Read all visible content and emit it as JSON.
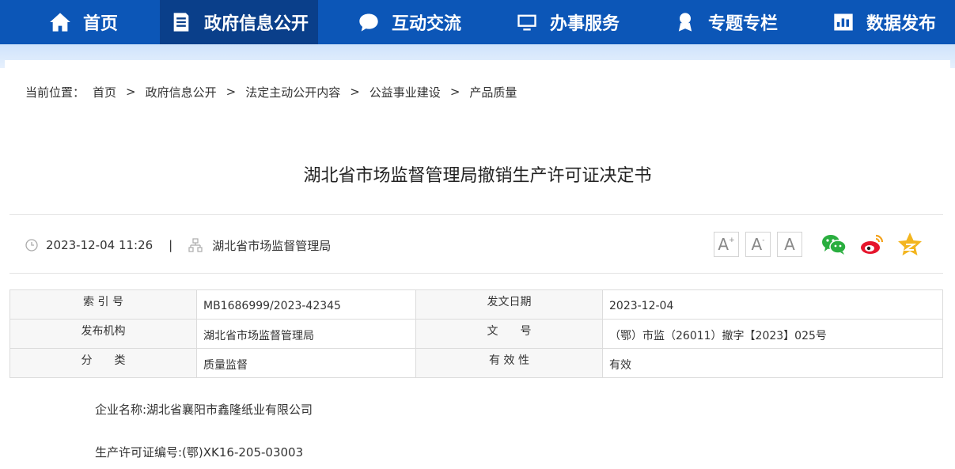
{
  "nav": {
    "items": [
      {
        "label": "首页",
        "icon": "home-icon"
      },
      {
        "label": "政府信息公开",
        "icon": "document-icon"
      },
      {
        "label": "互动交流",
        "icon": "chat-bubble-icon"
      },
      {
        "label": "办事服务",
        "icon": "monitor-icon"
      },
      {
        "label": "专题专栏",
        "icon": "medal-icon"
      },
      {
        "label": "数据发布",
        "icon": "bar-chart-icon"
      }
    ],
    "active_index": 1
  },
  "breadcrumb": {
    "prefix": "当前位置：",
    "items": [
      "首页",
      "政府信息公开",
      "法定主动公开内容",
      "公益事业建设",
      "产品质量"
    ],
    "separator": ">"
  },
  "article": {
    "title": "湖北省市场监督管理局撤销生产许可证决定书",
    "datetime": "2023-12-04 11:26",
    "divider": "|",
    "source": "湖北省市场监督管理局"
  },
  "font_controls": [
    "A",
    "A",
    "A"
  ],
  "font_control_marks": [
    "+",
    "-",
    ""
  ],
  "share_icons": [
    "wechat-icon",
    "weibo-icon",
    "favorite-star-icon"
  ],
  "info_table": {
    "rows": [
      [
        {
          "label": "索 引 号",
          "value": "MB1686999/2023-42345"
        },
        {
          "label": "发文日期",
          "value": "2023-12-04"
        }
      ],
      [
        {
          "label": "发布机构",
          "value": "湖北省市场监督管理局"
        },
        {
          "label": "文　　号",
          "value": "（鄂）市监（26011）撤字【2023】025号"
        }
      ],
      [
        {
          "label": "分　　类",
          "value": "质量监督"
        },
        {
          "label": "有 效 性",
          "value": "有效"
        }
      ]
    ]
  },
  "content": {
    "company": "企业名称:湖北省襄阳市鑫隆纸业有限公司",
    "license": "生产许可证编号:(鄂)XK16-205-03003"
  },
  "colors": {
    "nav_bg": "#0c56b7",
    "nav_active": "#0a3f8a",
    "band": "#d8e8fc",
    "wechat": "#2aae3f",
    "weibo": "#e6162d",
    "star": "#f3b51f"
  }
}
